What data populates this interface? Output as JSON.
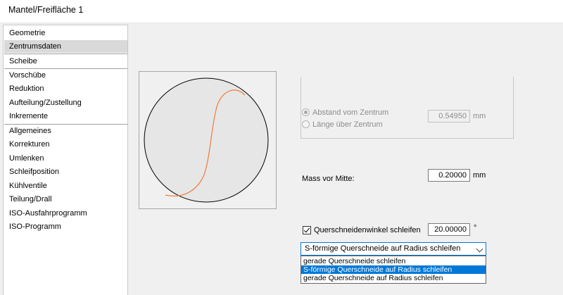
{
  "window": {
    "title": "Mantel/Freifläche 1"
  },
  "sidebar": {
    "groups": [
      [
        "Geometrie",
        "Zentrumsdaten",
        "Scheibe"
      ],
      [
        "Vorschübe",
        "Reduktion",
        "Aufteilung/Zustellung",
        "Inkremente"
      ],
      [
        "Allgemeines",
        "Korrekturen",
        "Umlenken",
        "Schleifposition",
        "Kühlventile",
        "Teilung/Drall",
        "ISO-Ausfahrprogramm",
        "ISO-Programm"
      ]
    ],
    "selected": "Zentrumsdaten"
  },
  "center_group": {
    "option_distance": "Abstand vom Zentrum",
    "option_length": "Länge über Zentrum",
    "selected": "option_distance",
    "value": "0.54950",
    "unit": "mm"
  },
  "mass": {
    "label": "Mass vor Mitte:",
    "value": "0.20000",
    "unit": "mm"
  },
  "cross_angle": {
    "label": "Querschneidenwinkel schleifen",
    "checked": true,
    "value": "20.00000",
    "unit": "°"
  },
  "combo": {
    "selected": "S-förmige Querschneide auf Radius schleifen",
    "options": [
      "gerade Querschneide schleifen",
      "S-förmige Querschneide auf Radius schleifen",
      "gerade Querschneide auf Radius schleifen"
    ],
    "highlighted_index": 1
  },
  "colors": {
    "accent": "#0078d7",
    "curve": "#f07a3a"
  }
}
